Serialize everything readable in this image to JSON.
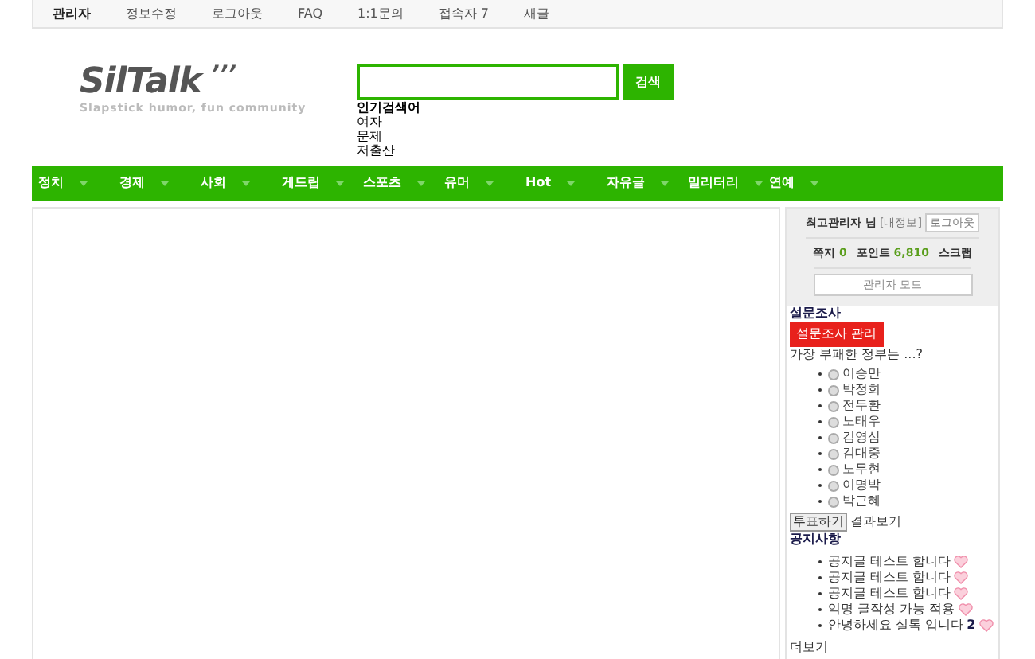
{
  "top_bar": {
    "items": [
      {
        "label": "관리자",
        "selected": true
      },
      {
        "label": "정보수정",
        "selected": false
      },
      {
        "label": "로그아웃",
        "selected": false
      },
      {
        "label": "FAQ",
        "selected": false
      },
      {
        "label": "1:1문의",
        "selected": false
      },
      {
        "label": "접속자 7",
        "selected": false
      },
      {
        "label": "새글",
        "selected": false
      }
    ]
  },
  "logo": {
    "name": "SilTalk",
    "marks": "’’’",
    "tagline": "Slapstick humor, fun community"
  },
  "search": {
    "button": "검색",
    "popular_title": "인기검색어",
    "popular": [
      "여자",
      "문제",
      "저출산"
    ]
  },
  "nav": {
    "items": [
      "정치",
      "경제",
      "사회",
      "게드립",
      "스포츠",
      "유머",
      "Hot",
      "자유글",
      "밀리터리",
      "연예"
    ]
  },
  "member": {
    "name": "최고관리자",
    "suffix": "님",
    "info_link": "[내정보]",
    "logout": "로그아웃",
    "memo_label": "쪽지",
    "memo_count": "0",
    "point_label": "포인트",
    "points": "6,810",
    "scrap": "스크랩",
    "admin_button": "관리자 모드"
  },
  "poll": {
    "title": "설문조사",
    "manage_button": "설문조사 관리",
    "question": "가장 부패한 정부는 ...?",
    "options": [
      {
        "label": "이승만",
        "selected": false
      },
      {
        "label": "박정희",
        "selected": false
      },
      {
        "label": "전두환",
        "selected": false
      },
      {
        "label": "노태우",
        "selected": false
      },
      {
        "label": "김영삼",
        "selected": false
      },
      {
        "label": "김대중",
        "selected": false
      },
      {
        "label": "노무현",
        "selected": false
      },
      {
        "label": "이명박",
        "selected": false
      },
      {
        "label": "박근혜",
        "selected": false
      }
    ],
    "vote_button": "투표하기",
    "results_link": "결과보기"
  },
  "notices": {
    "title": "공지사항",
    "items": [
      {
        "title": "공지글 테스트 합니다"
      },
      {
        "title": "공지글 테스트 합니다"
      },
      {
        "title": "공지글 테스트 합니다"
      },
      {
        "title": "익명 글작성 가능 적용"
      },
      {
        "title": "안녕하세요 실톡 입니다",
        "comments": "2"
      }
    ],
    "more": "더보기"
  }
}
